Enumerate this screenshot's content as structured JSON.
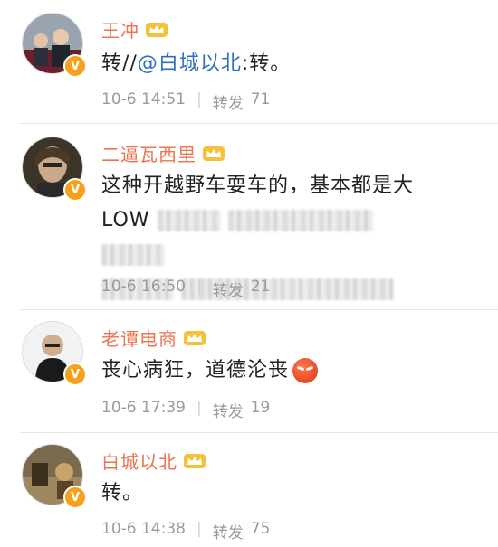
{
  "comments": [
    {
      "name": "王冲",
      "text_prefix": "转//",
      "mention": "@白城以北",
      "text_suffix": ":转。",
      "date": "10-6 14:51",
      "repost_label": "转发",
      "repost_count": "71"
    },
    {
      "name": "二逼瓦西里",
      "text_line1": "这种开越野车耍车的，基本都是大",
      "text_line2_start": "LOW",
      "date": "10-6 16:50",
      "repost_label": "转发",
      "repost_count": "21"
    },
    {
      "name": "老谭电商",
      "text": "丧心病狂，道德沦丧",
      "date": "10-6 17:39",
      "repost_label": "转发",
      "repost_count": "19"
    },
    {
      "name": "白城以北",
      "text": "转。",
      "date": "10-6 14:38",
      "repost_label": "转发",
      "repost_count": "75"
    }
  ],
  "verified_mark": "V",
  "colors": {
    "name": "#eb7350",
    "mention": "#2f6fbf",
    "meta": "#9a9a9a",
    "badge": "#f6a11c"
  },
  "icons": [
    "crown-icon",
    "verified-badge-icon",
    "angry-emoji-icon"
  ]
}
